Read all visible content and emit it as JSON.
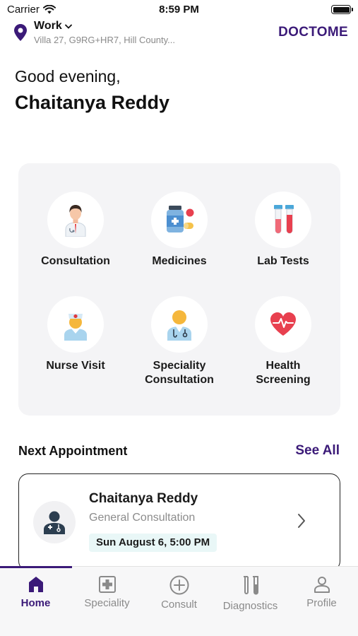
{
  "status_bar": {
    "carrier": "Carrier",
    "time": "8:59 PM"
  },
  "header": {
    "location_label": "Work",
    "location_address": "Villa 27, G9RG+HR7, Hill County...",
    "brand": "DOCTOME"
  },
  "greeting": {
    "salutation": "Good evening,",
    "name": "Chaitanya Reddy"
  },
  "services": [
    {
      "label": "Consultation",
      "icon": "doctor-icon"
    },
    {
      "label": "Medicines",
      "icon": "medicines-icon"
    },
    {
      "label": "Lab Tests",
      "icon": "test-tubes-icon"
    },
    {
      "label": "Nurse Visit",
      "icon": "nurse-icon"
    },
    {
      "label": "Speciality\nConsultation",
      "icon": "specialist-doctor-icon"
    },
    {
      "label": "Health\nScreening",
      "icon": "heart-pulse-icon"
    }
  ],
  "next_appointment": {
    "title": "Next Appointment",
    "see_all": "See All",
    "doctor_name": "Chaitanya Reddy",
    "type": "General Consultation",
    "datetime": "Sun August 6, 5:00 PM"
  },
  "tabs": [
    {
      "label": "Home",
      "icon": "home-icon",
      "active": true
    },
    {
      "label": "Speciality",
      "icon": "medical-cross-icon",
      "active": false
    },
    {
      "label": "Consult",
      "icon": "plus-circle-icon",
      "active": false
    },
    {
      "label": "Diagnostics",
      "icon": "test-tubes-icon",
      "active": false
    },
    {
      "label": "Profile",
      "icon": "person-icon",
      "active": false
    }
  ],
  "colors": {
    "brand": "#3b1a78",
    "card_bg": "#f4f4f6",
    "badge_bg": "#e9f7f7",
    "heart": "#e8404f"
  }
}
